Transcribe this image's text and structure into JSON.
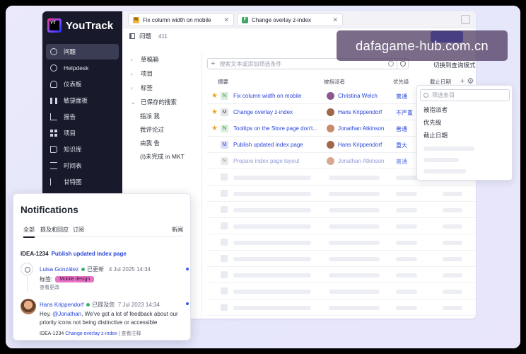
{
  "app": {
    "brand": "YouTrack",
    "brand_mark": "YT"
  },
  "sidebar": {
    "items": [
      {
        "label": "问题",
        "icon": "issues-check-icon",
        "active": true
      },
      {
        "label": "Helpdesk",
        "icon": "helpdesk-globe-icon"
      },
      {
        "label": "仪表板",
        "icon": "dashboard-gauge-icon"
      },
      {
        "label": "敏捷面板",
        "icon": "agile-board-icon"
      },
      {
        "label": "报告",
        "icon": "reports-chart-icon"
      },
      {
        "label": "项目",
        "icon": "projects-grid-icon"
      },
      {
        "label": "知识库",
        "icon": "knowledge-base-book-icon"
      },
      {
        "label": "时间表",
        "icon": "timesheet-hourglass-icon"
      },
      {
        "label": "甘特图",
        "icon": "gantt-chart-icon"
      }
    ]
  },
  "tabs": [
    {
      "label": "Fix column width on mobile",
      "badge": "M",
      "badge_color": "#f3b53b"
    },
    {
      "label": "Change overlay z-index",
      "badge": "F",
      "badge_color": "#3fa564"
    }
  ],
  "list_header": {
    "title": "问题",
    "count": "411"
  },
  "tree": {
    "items": [
      {
        "label": "草稿箱",
        "chevron": "›"
      },
      {
        "label": "项目",
        "chevron": "›"
      },
      {
        "label": "标签",
        "chevron": "›"
      },
      {
        "label": "已保存的搜索",
        "chevron": "⌄"
      }
    ],
    "sub_items": [
      "指派  我",
      "我评论过",
      "由我  告",
      "(I)未完成 in MKT"
    ]
  },
  "search": {
    "placeholder": "搜索文本或添加筛选条件",
    "query_mode": "切换到查询模式"
  },
  "columns": {
    "summary": "摘要",
    "assignee": "被指派者",
    "priority": "优先级",
    "due": "截止日期"
  },
  "issues": [
    {
      "starred": true,
      "type": "N",
      "type_bg": "#dbeedb",
      "type_fg": "#2c7a3f",
      "summary": "Fix column width on mobile",
      "assignee": "Christina Welch",
      "avatar": "#8a5a8e",
      "priority": "普通"
    },
    {
      "starred": true,
      "type": "M",
      "type_bg": "#e4e5ea",
      "type_fg": "#4d5160",
      "summary": "Change overlay z-index",
      "assignee": "Hans Krippendorf",
      "avatar": "#a0684a",
      "priority": "不严重"
    },
    {
      "starred": true,
      "type": "N",
      "type_bg": "#dbeedb",
      "type_fg": "#2c7a3f",
      "summary": "Tooltips on the Store page don't...",
      "assignee": "Jonathan Atkinson",
      "avatar": "#c98b6b",
      "priority": "普通"
    },
    {
      "starred": false,
      "type": "M",
      "type_bg": "#d9ddf8",
      "type_fg": "#3b4fc4",
      "summary": "Publish updated index page",
      "assignee": "Hans Krippendorf",
      "avatar": "#a0684a",
      "priority": "重大"
    },
    {
      "starred": false,
      "type": "N",
      "type_bg": "#e4e5ea",
      "type_fg": "#6f7384",
      "summary": "Prepare index page layout",
      "assignee": "Jonathan Atkinson",
      "avatar": "#c98b6b",
      "priority": "普通",
      "muted": true
    }
  ],
  "column_dropdown": {
    "placeholder": "筛选条目",
    "items": [
      "被指派者",
      "优先级",
      "截止日期"
    ]
  },
  "notifications": {
    "title": "Notifications",
    "tabs": [
      "全部",
      "提及和回应",
      "订阅"
    ],
    "right_tab": "新闻",
    "issue_id": "IDEA-1234",
    "issue_title": "Publish updated index page",
    "event1": {
      "user": "Luisa González",
      "action": "已更新",
      "date": "4 Jul 2025 14:34",
      "tag_label": "标签:",
      "tag": "Mobile design",
      "tag_color": "#e774c7",
      "more": "查看更改"
    },
    "event2": {
      "user": "Hans Krippendorf",
      "action": "已提及您",
      "date": "7 Jul 2023 14:34",
      "message_prefix": "Hey, ",
      "mention": "@Jonathan",
      "message_rest": ", We've got a lot of feedback about our priority icons not being distinctive or accessible",
      "foot_id": "IDEA-1234",
      "foot_link": "Change overlay z-index",
      "foot_sep": "|",
      "foot_action": "查看注释"
    }
  },
  "watermark": "dafagame-hub.com.cn",
  "colors": {
    "accent": "#2a46d9",
    "sidebar": "#181a2c",
    "primary_button": "#4b62e8",
    "star": "#f2a224"
  }
}
